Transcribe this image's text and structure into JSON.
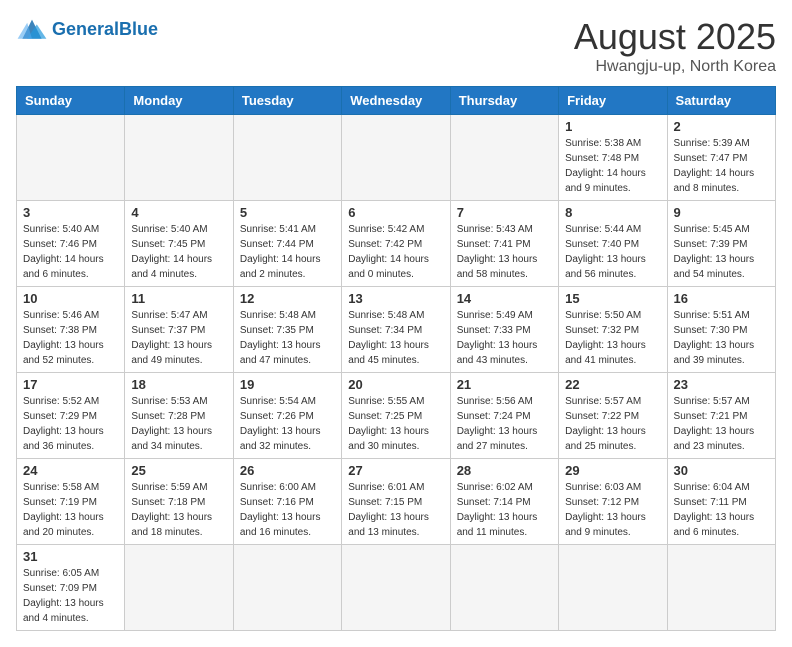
{
  "header": {
    "logo_general": "General",
    "logo_blue": "Blue",
    "month_title": "August 2025",
    "location": "Hwangju-up, North Korea"
  },
  "weekdays": [
    "Sunday",
    "Monday",
    "Tuesday",
    "Wednesday",
    "Thursday",
    "Friday",
    "Saturday"
  ],
  "weeks": [
    [
      {
        "day": "",
        "info": ""
      },
      {
        "day": "",
        "info": ""
      },
      {
        "day": "",
        "info": ""
      },
      {
        "day": "",
        "info": ""
      },
      {
        "day": "",
        "info": ""
      },
      {
        "day": "1",
        "info": "Sunrise: 5:38 AM\nSunset: 7:48 PM\nDaylight: 14 hours and 9 minutes."
      },
      {
        "day": "2",
        "info": "Sunrise: 5:39 AM\nSunset: 7:47 PM\nDaylight: 14 hours and 8 minutes."
      }
    ],
    [
      {
        "day": "3",
        "info": "Sunrise: 5:40 AM\nSunset: 7:46 PM\nDaylight: 14 hours and 6 minutes."
      },
      {
        "day": "4",
        "info": "Sunrise: 5:40 AM\nSunset: 7:45 PM\nDaylight: 14 hours and 4 minutes."
      },
      {
        "day": "5",
        "info": "Sunrise: 5:41 AM\nSunset: 7:44 PM\nDaylight: 14 hours and 2 minutes."
      },
      {
        "day": "6",
        "info": "Sunrise: 5:42 AM\nSunset: 7:42 PM\nDaylight: 14 hours and 0 minutes."
      },
      {
        "day": "7",
        "info": "Sunrise: 5:43 AM\nSunset: 7:41 PM\nDaylight: 13 hours and 58 minutes."
      },
      {
        "day": "8",
        "info": "Sunrise: 5:44 AM\nSunset: 7:40 PM\nDaylight: 13 hours and 56 minutes."
      },
      {
        "day": "9",
        "info": "Sunrise: 5:45 AM\nSunset: 7:39 PM\nDaylight: 13 hours and 54 minutes."
      }
    ],
    [
      {
        "day": "10",
        "info": "Sunrise: 5:46 AM\nSunset: 7:38 PM\nDaylight: 13 hours and 52 minutes."
      },
      {
        "day": "11",
        "info": "Sunrise: 5:47 AM\nSunset: 7:37 PM\nDaylight: 13 hours and 49 minutes."
      },
      {
        "day": "12",
        "info": "Sunrise: 5:48 AM\nSunset: 7:35 PM\nDaylight: 13 hours and 47 minutes."
      },
      {
        "day": "13",
        "info": "Sunrise: 5:48 AM\nSunset: 7:34 PM\nDaylight: 13 hours and 45 minutes."
      },
      {
        "day": "14",
        "info": "Sunrise: 5:49 AM\nSunset: 7:33 PM\nDaylight: 13 hours and 43 minutes."
      },
      {
        "day": "15",
        "info": "Sunrise: 5:50 AM\nSunset: 7:32 PM\nDaylight: 13 hours and 41 minutes."
      },
      {
        "day": "16",
        "info": "Sunrise: 5:51 AM\nSunset: 7:30 PM\nDaylight: 13 hours and 39 minutes."
      }
    ],
    [
      {
        "day": "17",
        "info": "Sunrise: 5:52 AM\nSunset: 7:29 PM\nDaylight: 13 hours and 36 minutes."
      },
      {
        "day": "18",
        "info": "Sunrise: 5:53 AM\nSunset: 7:28 PM\nDaylight: 13 hours and 34 minutes."
      },
      {
        "day": "19",
        "info": "Sunrise: 5:54 AM\nSunset: 7:26 PM\nDaylight: 13 hours and 32 minutes."
      },
      {
        "day": "20",
        "info": "Sunrise: 5:55 AM\nSunset: 7:25 PM\nDaylight: 13 hours and 30 minutes."
      },
      {
        "day": "21",
        "info": "Sunrise: 5:56 AM\nSunset: 7:24 PM\nDaylight: 13 hours and 27 minutes."
      },
      {
        "day": "22",
        "info": "Sunrise: 5:57 AM\nSunset: 7:22 PM\nDaylight: 13 hours and 25 minutes."
      },
      {
        "day": "23",
        "info": "Sunrise: 5:57 AM\nSunset: 7:21 PM\nDaylight: 13 hours and 23 minutes."
      }
    ],
    [
      {
        "day": "24",
        "info": "Sunrise: 5:58 AM\nSunset: 7:19 PM\nDaylight: 13 hours and 20 minutes."
      },
      {
        "day": "25",
        "info": "Sunrise: 5:59 AM\nSunset: 7:18 PM\nDaylight: 13 hours and 18 minutes."
      },
      {
        "day": "26",
        "info": "Sunrise: 6:00 AM\nSunset: 7:16 PM\nDaylight: 13 hours and 16 minutes."
      },
      {
        "day": "27",
        "info": "Sunrise: 6:01 AM\nSunset: 7:15 PM\nDaylight: 13 hours and 13 minutes."
      },
      {
        "day": "28",
        "info": "Sunrise: 6:02 AM\nSunset: 7:14 PM\nDaylight: 13 hours and 11 minutes."
      },
      {
        "day": "29",
        "info": "Sunrise: 6:03 AM\nSunset: 7:12 PM\nDaylight: 13 hours and 9 minutes."
      },
      {
        "day": "30",
        "info": "Sunrise: 6:04 AM\nSunset: 7:11 PM\nDaylight: 13 hours and 6 minutes."
      }
    ],
    [
      {
        "day": "31",
        "info": "Sunrise: 6:05 AM\nSunset: 7:09 PM\nDaylight: 13 hours and 4 minutes."
      },
      {
        "day": "",
        "info": ""
      },
      {
        "day": "",
        "info": ""
      },
      {
        "day": "",
        "info": ""
      },
      {
        "day": "",
        "info": ""
      },
      {
        "day": "",
        "info": ""
      },
      {
        "day": "",
        "info": ""
      }
    ]
  ]
}
